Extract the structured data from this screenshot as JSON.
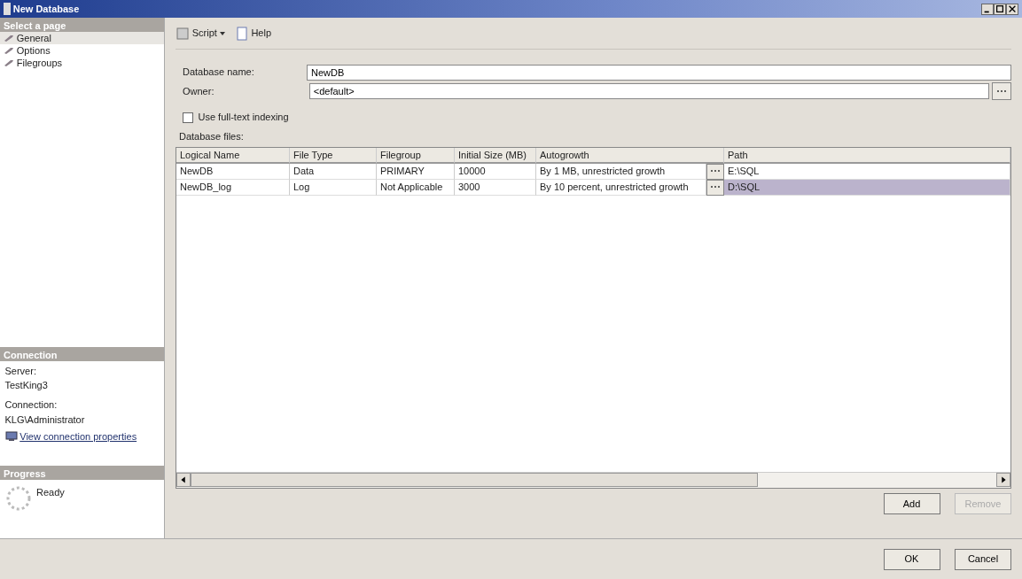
{
  "window": {
    "title": "New Database"
  },
  "sidebar": {
    "header": "Select a page",
    "items": [
      {
        "label": "General",
        "selected": true
      },
      {
        "label": "Options",
        "selected": false
      },
      {
        "label": "Filegroups",
        "selected": false
      }
    ]
  },
  "connection": {
    "header": "Connection",
    "server_label": "Server:",
    "server": "TestKing3",
    "connection_label": "Connection:",
    "connection": "KLG\\Administrator",
    "link": "View connection properties"
  },
  "progress": {
    "header": "Progress",
    "status": "Ready"
  },
  "toolbar": [
    "Script",
    "Help"
  ],
  "form": {
    "name_label": "Database name:",
    "name": "NewDB",
    "owner_label": "Owner:",
    "owner": "<default>",
    "fulltext_label": "Use full-text indexing",
    "fulltext": false
  },
  "files": {
    "label": "Database files:",
    "columns": [
      "Logical Name",
      "File Type",
      "Filegroup",
      "Initial Size (MB)",
      "Autogrowth",
      "Path"
    ],
    "rows": [
      {
        "cells": [
          "NewDB",
          "Data",
          "PRIMARY",
          "10000",
          "By 1 MB, unrestricted growth",
          "E:\\SQL"
        ],
        "selected": false
      },
      {
        "cells": [
          "NewDB_log",
          "Log",
          "Not Applicable",
          "3000",
          "By 10 percent, unrestricted growth",
          "D:\\SQL"
        ],
        "selected": true
      }
    ]
  },
  "buttons": [
    {
      "label": "Add",
      "disabled": false
    },
    {
      "label": "Remove",
      "disabled": true
    }
  ],
  "footer_buttons": [
    "OK",
    "Cancel"
  ]
}
